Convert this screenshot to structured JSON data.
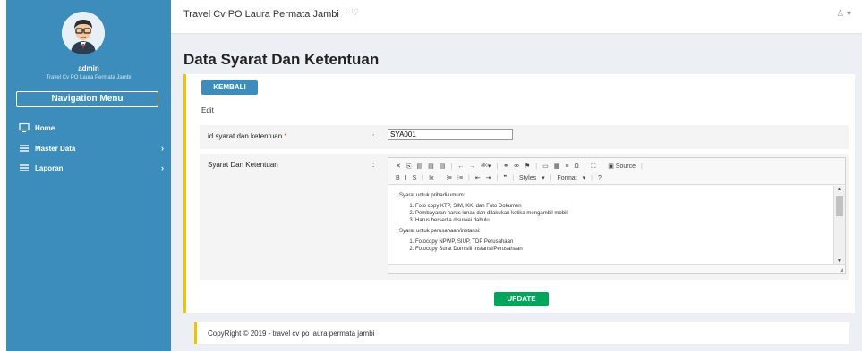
{
  "sidebar": {
    "user_name": "admin",
    "user_org": "Travel Cv PO Laura Permata Jambi",
    "nav_header": "Navigation Menu",
    "items": [
      {
        "label": "Home",
        "icon": "monitor-icon",
        "has_chevron": false
      },
      {
        "label": "Master Data",
        "icon": "bars-icon",
        "has_chevron": true
      },
      {
        "label": "Laporan",
        "icon": "bars-icon",
        "has_chevron": true
      }
    ],
    "chevron": "›"
  },
  "header": {
    "brand": "Travel Cv PO Laura Permata Jambi",
    "brand_icon": "·  ♡",
    "user_icon": "♙ ▾"
  },
  "page_title": "Data Syarat Dan Ketentuan",
  "box": {
    "back_label": "KEMBALI",
    "edit_label": "Edit",
    "fields": {
      "id_label": "id syarat dan ketentuan",
      "required_mark": "*",
      "colon": ":",
      "id_value": "SYA001",
      "terms_label": "Syarat Dan Ketentuan"
    },
    "editor": {
      "toolbar_row1": [
        "✕",
        "⎘",
        "▤",
        "▤",
        "▤",
        "|",
        "←",
        "→",
        "ᵃᵇᶜ▾",
        "|",
        "⚭",
        "⚮",
        "⚑",
        "|",
        "▭",
        "▦",
        "≡",
        "Ω",
        "|",
        "⛶",
        "|",
        "▣ Source",
        "|"
      ],
      "toolbar_row2": [
        "B",
        "I",
        "S",
        "|",
        "Ix",
        "|",
        "⁝≡",
        "⁝≡",
        "|",
        "⇤",
        "⇥",
        "|",
        "❞",
        "|",
        "Styles",
        "▾",
        "|",
        "Format",
        "▾",
        "|",
        "?"
      ],
      "heading1": "Syarat untuk pribadi/umum:",
      "list1": [
        "Foto copy KTP, SIM, KK, dan Foto Dokumen",
        "Pembayaran harus lunas dan dilakukan ketika mengambil mobil.",
        "Harus bersedia disurvei dahulu"
      ],
      "heading2": "Syarat untuk perusahaan/instansi:",
      "list2": [
        "Fotocopy NPWP, SIUP,  TDP Perusahaan",
        "Fotocopy Surat Domisili Instansi/Perusahaan"
      ]
    },
    "update_label": "UPDATE"
  },
  "footer": {
    "text": "CopyRight © 2019 - travel cv po laura permata jambi"
  },
  "colors": {
    "sidebar_bg": "#3c8dbc",
    "primary_button": "#3c8dbc",
    "success_button": "#00a65a",
    "box_accent": "#f3c300",
    "page_bg": "#ecf0f5"
  }
}
